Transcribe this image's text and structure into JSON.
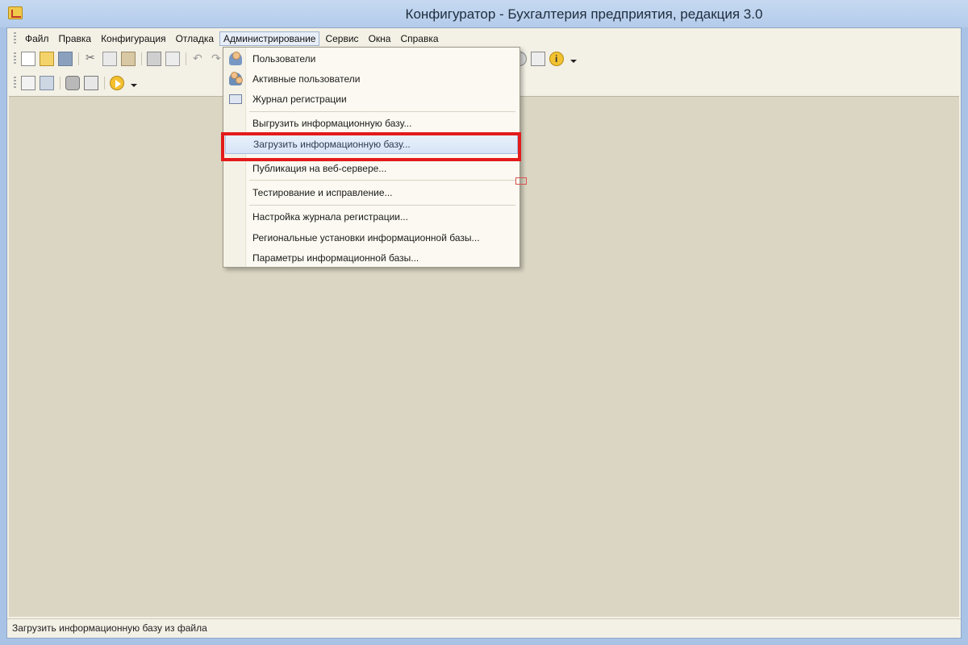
{
  "window": {
    "title": "Конфигуратор - Бухгалтерия предприятия, редакция 3.0"
  },
  "menubar": {
    "items": [
      {
        "label": "Файл"
      },
      {
        "label": "Правка"
      },
      {
        "label": "Конфигурация"
      },
      {
        "label": "Отладка"
      },
      {
        "label": "Администрирование",
        "active": true
      },
      {
        "label": "Сервис"
      },
      {
        "label": "Окна"
      },
      {
        "label": "Справка"
      }
    ]
  },
  "admin_menu": {
    "items": [
      {
        "label": "Пользователи",
        "icon": "user-icon"
      },
      {
        "label": "Активные пользователи",
        "icon": "active-users-icon"
      },
      {
        "label": "Журнал регистрации",
        "icon": "journal-icon"
      },
      {
        "label": "Выгрузить информационную базу..."
      },
      {
        "label": "Загрузить информационную базу...",
        "highlighted": true
      },
      {
        "label": "Публикация на веб-сервере..."
      },
      {
        "label": "Тестирование и исправление..."
      },
      {
        "label": "Настройка журнала регистрации..."
      },
      {
        "label": "Региональные установки информационной базы..."
      },
      {
        "label": "Параметры информационной базы..."
      }
    ]
  },
  "statusbar": {
    "text": "Загрузить информационную базу из файла"
  },
  "colors": {
    "highlight_frame": "#e31b1b",
    "workspace": "#dbd6c3",
    "title_bar": "#b3cbea"
  }
}
